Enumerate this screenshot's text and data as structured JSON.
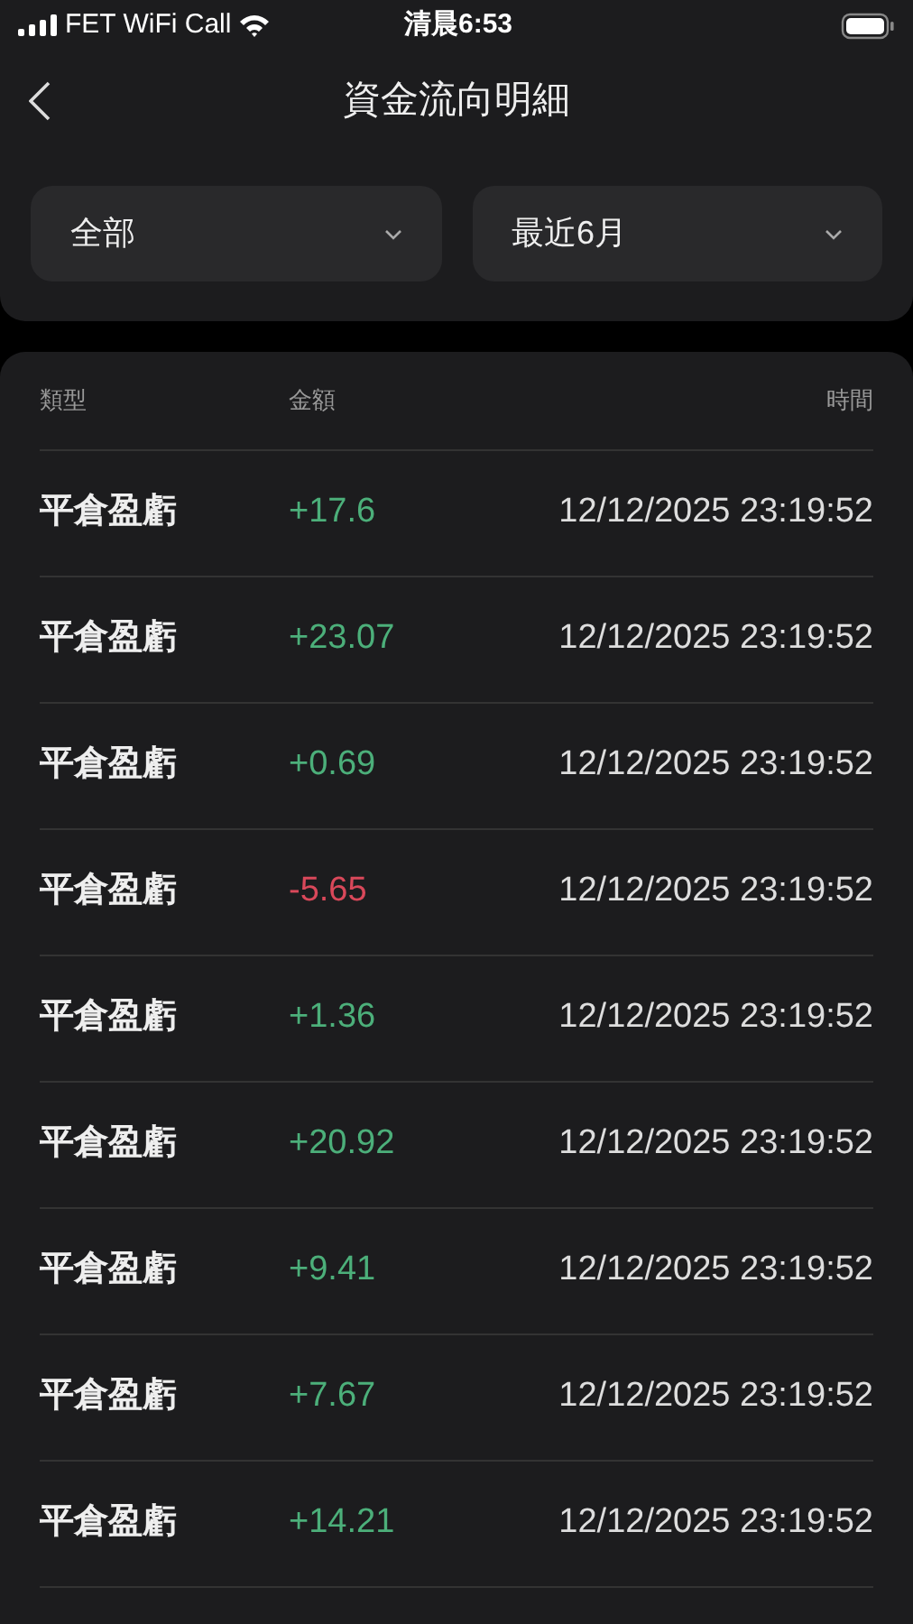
{
  "status_bar": {
    "carrier": "FET WiFi Call",
    "time": "清晨6:53"
  },
  "header": {
    "title": "資金流向明細"
  },
  "filters": [
    {
      "value": "全部"
    },
    {
      "value": "最近6月"
    }
  ],
  "table": {
    "columns": [
      "類型",
      "金額",
      "時間"
    ],
    "rows": [
      {
        "type": "平倉盈虧",
        "amount": "+17.6",
        "color": "#4caf7a",
        "time": "12/12/2025 23:19:52"
      },
      {
        "type": "平倉盈虧",
        "amount": "+23.07",
        "color": "#4caf7a",
        "time": "12/12/2025 23:19:52"
      },
      {
        "type": "平倉盈虧",
        "amount": "+0.69",
        "color": "#4caf7a",
        "time": "12/12/2025 23:19:52"
      },
      {
        "type": "平倉盈虧",
        "amount": "-5.65",
        "color": "#d9485a",
        "time": "12/12/2025 23:19:52"
      },
      {
        "type": "平倉盈虧",
        "amount": "+1.36",
        "color": "#4caf7a",
        "time": "12/12/2025 23:19:52"
      },
      {
        "type": "平倉盈虧",
        "amount": "+20.92",
        "color": "#4caf7a",
        "time": "12/12/2025 23:19:52"
      },
      {
        "type": "平倉盈虧",
        "amount": "+9.41",
        "color": "#4caf7a",
        "time": "12/12/2025 23:19:52"
      },
      {
        "type": "平倉盈虧",
        "amount": "+7.67",
        "color": "#4caf7a",
        "time": "12/12/2025 23:19:52"
      },
      {
        "type": "平倉盈虧",
        "amount": "+14.21",
        "color": "#4caf7a",
        "time": "12/12/2025 23:19:52"
      }
    ]
  }
}
